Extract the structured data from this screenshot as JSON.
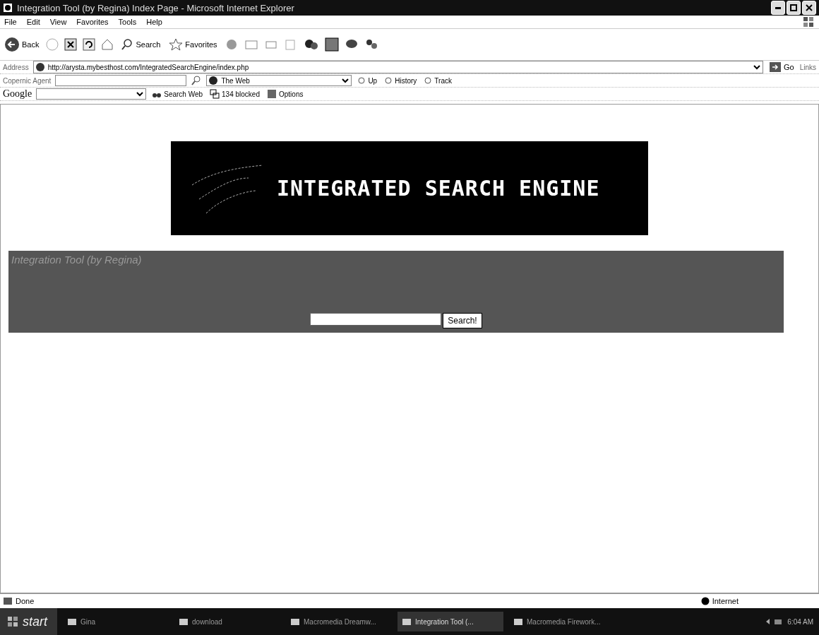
{
  "window": {
    "title": "Integration Tool (by Regina) Index Page - Microsoft Internet Explorer"
  },
  "menu": [
    "File",
    "Edit",
    "View",
    "Favorites",
    "Tools",
    "Help"
  ],
  "toolbar": [
    {
      "kind": "back",
      "label": "Back"
    },
    {
      "kind": "search",
      "label": "Search"
    },
    {
      "kind": "favorites",
      "label": "Favorites"
    }
  ],
  "address": {
    "label": "Address",
    "url": "http://arysta.mybesthost.com/IntegratedSearchEngine/index.php",
    "go": "Go",
    "links": "Links"
  },
  "copernic": {
    "label": "Copernic Agent",
    "scope": "The Web",
    "buttons": [
      "Up",
      "History",
      "Track"
    ]
  },
  "google": {
    "label": "Google",
    "search": "Search Web",
    "blocked": "134 blocked",
    "options": "Options"
  },
  "page": {
    "logo_text": "INTEGRATED SEARCH ENGINE",
    "heading": "Integration Tool (by Regina)",
    "search_button": "Search!"
  },
  "status_bar": {
    "status": "Done",
    "zone": "Internet"
  },
  "taskbar": {
    "start": "start",
    "items": [
      {
        "label": "Gina",
        "selected": false
      },
      {
        "label": "download",
        "selected": false
      },
      {
        "label": "Macromedia Dreamw...",
        "selected": false
      },
      {
        "label": "Integration Tool (...",
        "selected": true
      },
      {
        "label": "Macromedia Firework...",
        "selected": false
      }
    ],
    "clock": "6:04 AM"
  }
}
